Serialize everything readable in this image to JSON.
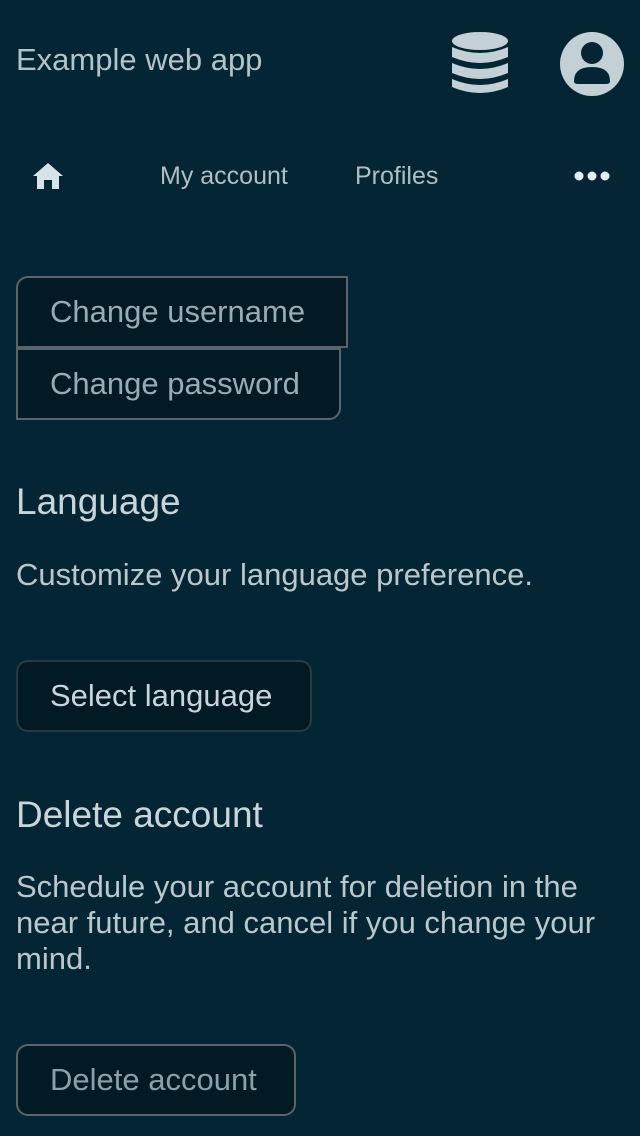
{
  "header": {
    "app_title": "Example web app",
    "database_icon": "database-icon",
    "account_icon": "account-circle-icon"
  },
  "nav": {
    "home_icon": "home-icon",
    "my_account": "My account",
    "profiles": "Profiles",
    "more_icon": "more-horizontal-icon"
  },
  "account_actions": {
    "change_username": "Change username",
    "change_password": "Change password"
  },
  "language": {
    "title": "Language",
    "description": "Customize your language preference.",
    "button": "Select language"
  },
  "delete": {
    "title": "Delete account",
    "description": "Schedule your account for deletion in the near future, and cancel if you change your mind.",
    "button": "Delete account"
  },
  "colors": {
    "background": "#042533",
    "button_bg": "#021a23",
    "text": "#c8d6dc"
  }
}
